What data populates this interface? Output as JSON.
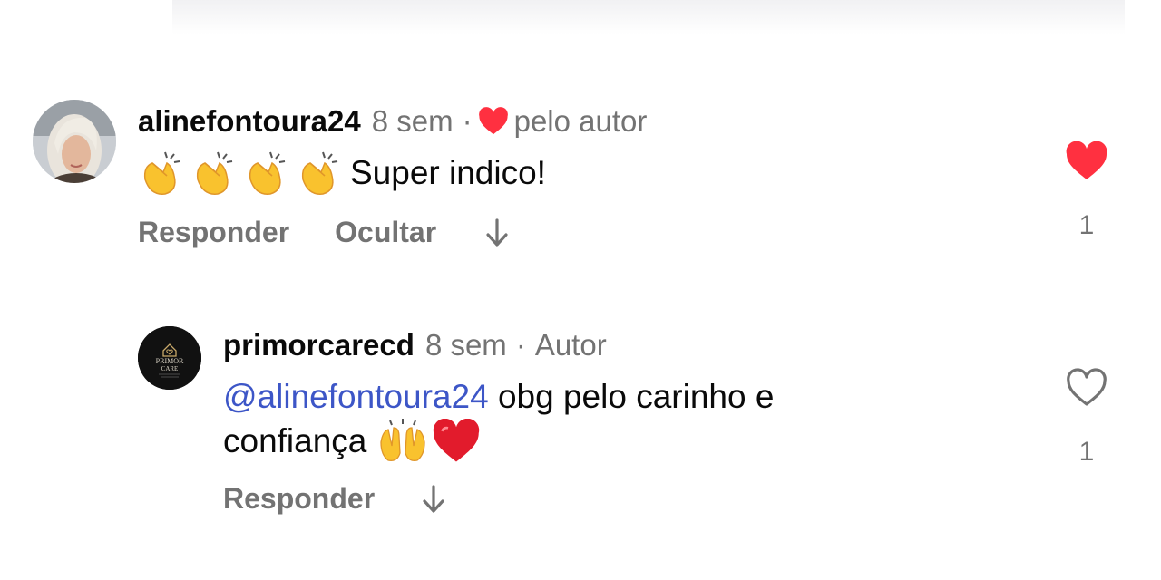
{
  "comments": [
    {
      "username": "alinefontoura24",
      "time": "8 sem",
      "separator": "·",
      "liked_by_author_label": "pelo autor",
      "text": "Super indico!",
      "actions": {
        "reply": "Responder",
        "hide": "Ocultar"
      },
      "liked": true,
      "like_count": "1",
      "colors": {
        "like": "#ff3040"
      }
    },
    {
      "username": "primorcarecd",
      "time": "8 sem",
      "separator": "·",
      "author_label": "Autor",
      "mention": "@alinefontoura24",
      "text_line1": "obg pelo carinho e",
      "text_line2": "confiança",
      "avatar_brand": "PRIMOR",
      "avatar_brand2": "CARE",
      "actions": {
        "reply": "Responder"
      },
      "liked": false,
      "like_count": "1"
    }
  ]
}
